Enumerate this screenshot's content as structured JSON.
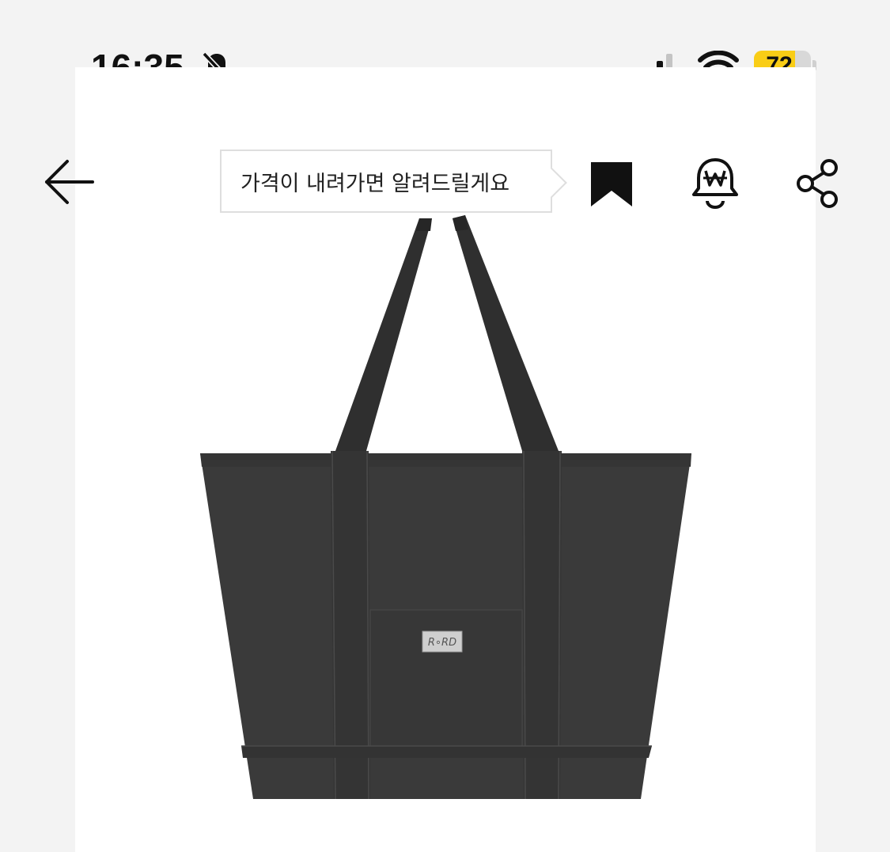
{
  "status_bar": {
    "time": "16:35",
    "battery_level": "72",
    "battery_fraction": 0.72,
    "battery_color": "#f9cd16",
    "icons": [
      "bell-slash-icon",
      "cellular-signal-icon",
      "wifi-icon"
    ]
  },
  "nav": {
    "back_icon": "arrow-left-icon",
    "tooltip_text": "가격이 내려가면 알려드릴게요",
    "actions": [
      "bookmark-icon",
      "price-alert-bell-icon",
      "share-icon"
    ]
  },
  "product": {
    "image": "tote-bag-image",
    "color": "#3a3a3a"
  }
}
